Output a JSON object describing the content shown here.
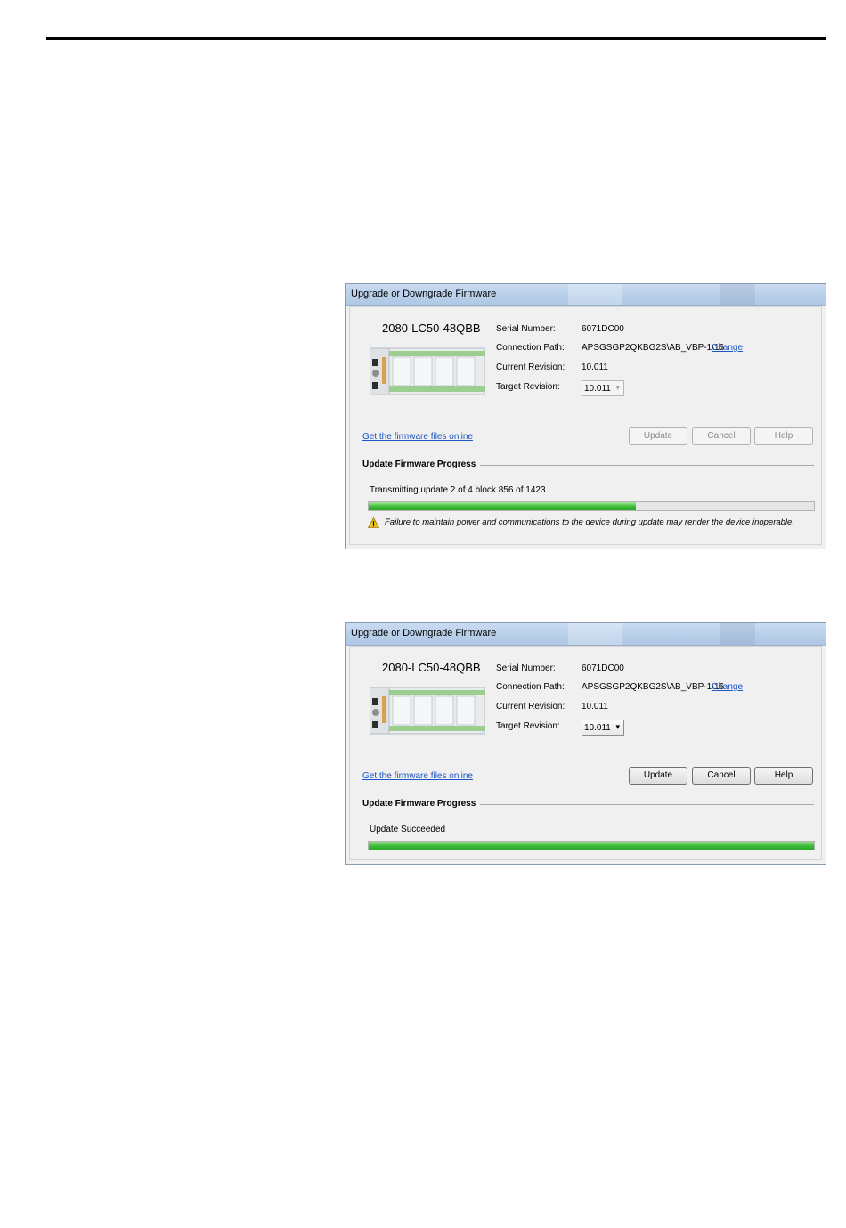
{
  "dialogs": [
    {
      "title": "Upgrade or Downgrade Firmware",
      "model": "2080-LC50-48QBB",
      "serial_label": "Serial Number:",
      "serial_value": "6071DC00",
      "path_label": "Connection Path:",
      "path_value": "APSGSGP2QKBG2S\\AB_VBP-1\\16",
      "change_link": "Change",
      "current_label": "Current Revision:",
      "current_value": "10.011",
      "target_label": "Target Revision:",
      "target_value": "10.011",
      "firmware_link": "Get the firmware files online",
      "update_label": "Update",
      "cancel_label": "Cancel",
      "help_label": "Help",
      "buttons_enabled": false,
      "progress_title": "Update Firmware Progress",
      "status_text": "Transmitting update 2 of 4  block 856 of 1423",
      "progress_fraction": 0.6,
      "warning_text": "Failure to maintain power and communications to the device during update may render the device inoperable."
    },
    {
      "title": "Upgrade or Downgrade Firmware",
      "model": "2080-LC50-48QBB",
      "serial_label": "Serial Number:",
      "serial_value": "6071DC00",
      "path_label": "Connection Path:",
      "path_value": "APSGSGP2QKBG2S\\AB_VBP-1\\16",
      "change_link": "Change",
      "current_label": "Current Revision:",
      "current_value": "10.011",
      "target_label": "Target Revision:",
      "target_value": "10.011",
      "firmware_link": "Get the firmware files online",
      "update_label": "Update",
      "cancel_label": "Cancel",
      "help_label": "Help",
      "buttons_enabled": true,
      "progress_title": "Update Firmware Progress",
      "status_text": "Update Succeeded",
      "progress_fraction": 1.0
    }
  ],
  "colors": {
    "link": "#1a56c4",
    "progress_green": "#3fbd3a",
    "warning_yellow": "#f5c518"
  },
  "icons": [
    "controller-device-icon",
    "warning-icon",
    "chevron-down-icon"
  ]
}
